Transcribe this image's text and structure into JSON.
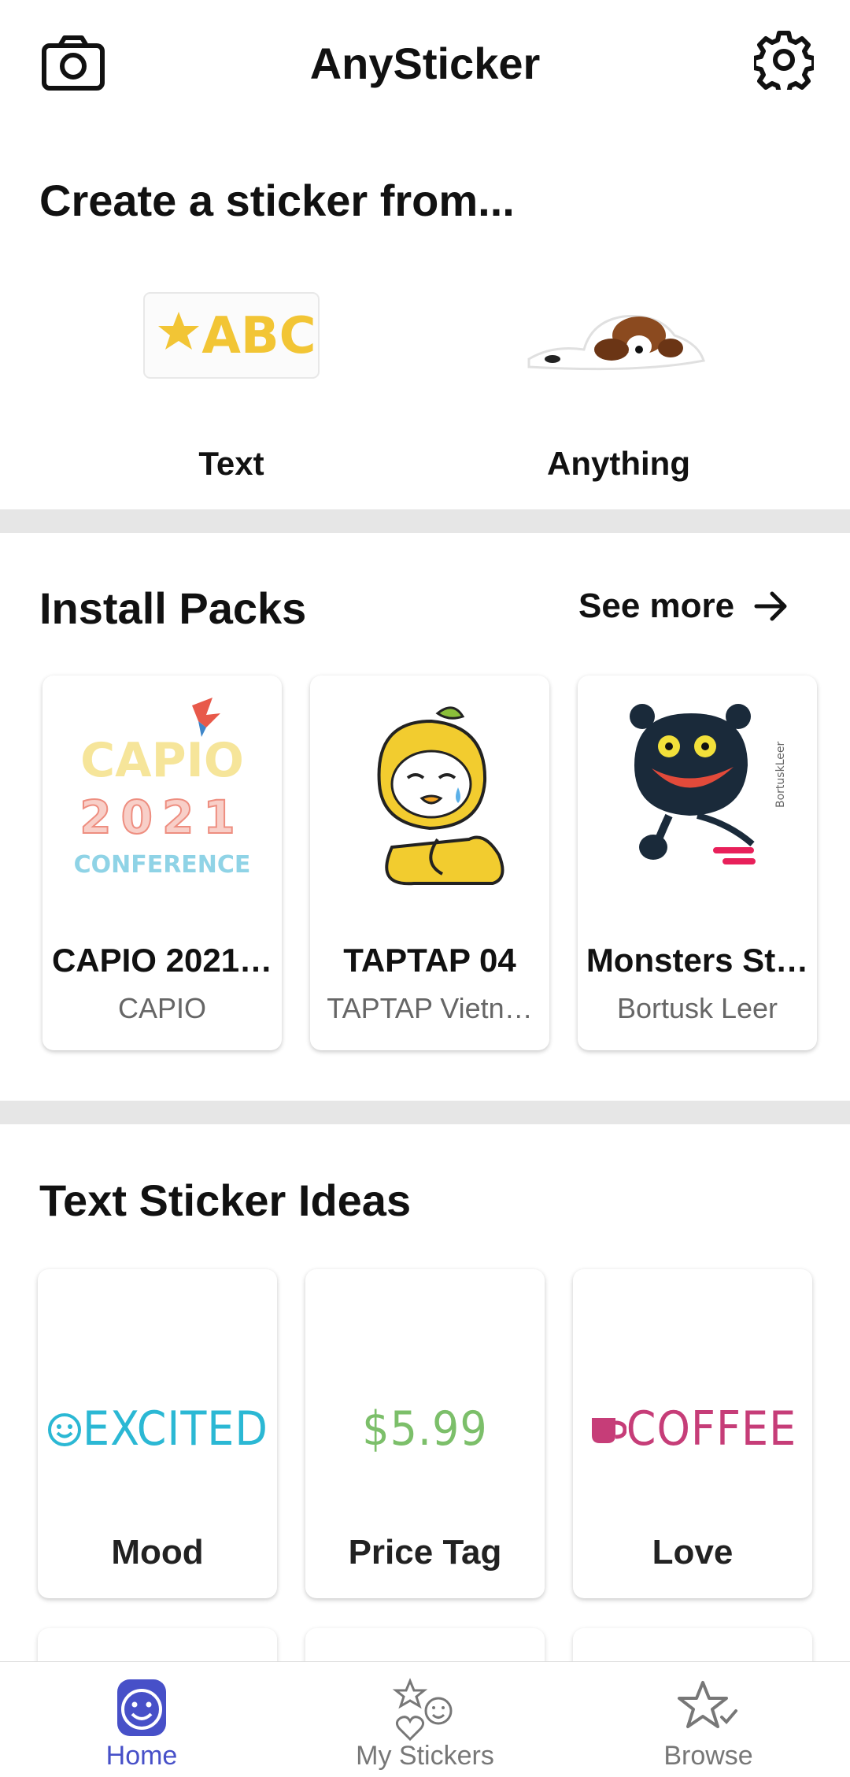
{
  "app": {
    "title": "AnySticker"
  },
  "create": {
    "heading": "Create a sticker from...",
    "options": [
      {
        "label": "Text",
        "preview_text": "ABC"
      },
      {
        "label": "Anything"
      }
    ]
  },
  "packs": {
    "heading": "Install Packs",
    "see_more": "See more",
    "items": [
      {
        "name": "CAPIO 2021…",
        "author": "CAPIO",
        "logo_lines": [
          "CAPIO",
          "2021",
          "CONFERENCE"
        ]
      },
      {
        "name": "TAPTAP 04",
        "author": "TAPTAP Vietn…"
      },
      {
        "name": "Monsters St…",
        "author": "Bortusk Leer",
        "signature": "BortuskLeer"
      }
    ]
  },
  "ideas": {
    "heading": "Text Sticker Ideas",
    "items": [
      {
        "label": "Mood",
        "preview_text": "EXCITED",
        "color": "#2bb8d4"
      },
      {
        "label": "Price Tag",
        "preview_text": "$5.99",
        "color": "#7cbf6a"
      },
      {
        "label": "Love",
        "preview_text": "COFFEE",
        "color": "#c63d78"
      }
    ]
  },
  "nav": {
    "items": [
      {
        "label": "Home",
        "icon": "home-smiley-icon",
        "active": true
      },
      {
        "label": "My Stickers",
        "icon": "my-stickers-icon",
        "active": false
      },
      {
        "label": "Browse",
        "icon": "browse-star-icon",
        "active": false
      }
    ]
  },
  "colors": {
    "accent": "#4750c8",
    "divider": "#e6e6e6",
    "text_secondary": "#666666"
  }
}
